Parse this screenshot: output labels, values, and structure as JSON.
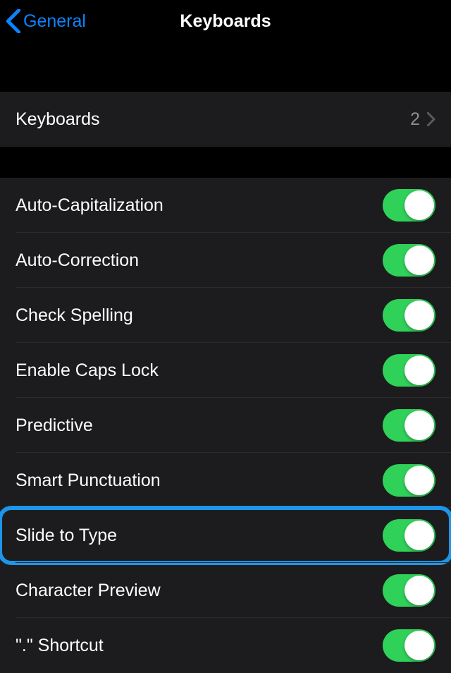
{
  "nav": {
    "back_label": "General",
    "title": "Keyboards"
  },
  "section1": {
    "keyboards": {
      "label": "Keyboards",
      "count": "2"
    }
  },
  "section2": {
    "items": [
      {
        "id": "auto-capitalization",
        "label": "Auto-Capitalization",
        "on": true,
        "highlight": false
      },
      {
        "id": "auto-correction",
        "label": "Auto-Correction",
        "on": true,
        "highlight": false
      },
      {
        "id": "check-spelling",
        "label": "Check Spelling",
        "on": true,
        "highlight": false
      },
      {
        "id": "enable-caps-lock",
        "label": "Enable Caps Lock",
        "on": true,
        "highlight": false
      },
      {
        "id": "predictive",
        "label": "Predictive",
        "on": true,
        "highlight": false
      },
      {
        "id": "smart-punctuation",
        "label": "Smart Punctuation",
        "on": true,
        "highlight": false
      },
      {
        "id": "slide-to-type",
        "label": "Slide to Type",
        "on": true,
        "highlight": true
      },
      {
        "id": "character-preview",
        "label": "Character Preview",
        "on": true,
        "highlight": false
      },
      {
        "id": "period-shortcut",
        "label": "\".\" Shortcut",
        "on": true,
        "highlight": false
      }
    ]
  },
  "colors": {
    "accent_blue": "#0a84ff",
    "toggle_green": "#30d158",
    "highlight_blue": "#1e95e8"
  }
}
